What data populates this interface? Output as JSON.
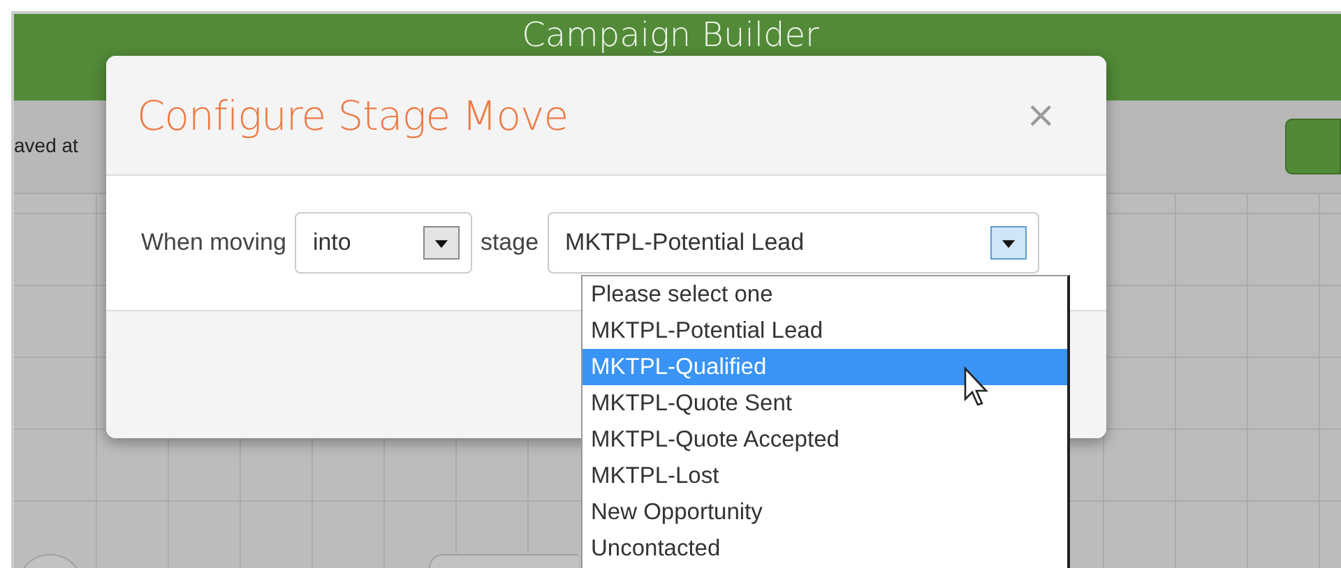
{
  "app": {
    "title": "Campaign Builder",
    "saved_text": "aved at"
  },
  "dialog": {
    "title": "Configure Stage Move",
    "close": "×",
    "label_before": "When moving",
    "direction": {
      "value": "into"
    },
    "label_middle": "stage",
    "stage": {
      "value": "MKTPL-Potential Lead"
    }
  },
  "dropdown": {
    "options": [
      {
        "label": "Please select one",
        "selected": false
      },
      {
        "label": "MKTPL-Potential Lead",
        "selected": false
      },
      {
        "label": "MKTPL-Qualified",
        "selected": true
      },
      {
        "label": "MKTPL-Quote Sent",
        "selected": false
      },
      {
        "label": "MKTPL-Quote Accepted",
        "selected": false
      },
      {
        "label": "MKTPL-Lost",
        "selected": false
      },
      {
        "label": "New Opportunity",
        "selected": false
      },
      {
        "label": "Uncontacted",
        "selected": false
      }
    ]
  }
}
